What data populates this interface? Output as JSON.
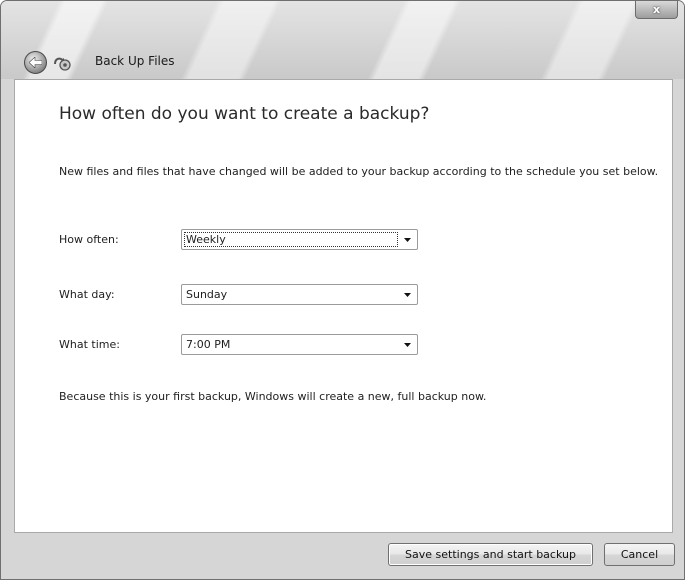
{
  "window": {
    "title": "Back Up Files",
    "close_glyph": "x",
    "icons": {
      "back": "back-arrow-icon",
      "app": "backup-app-icon",
      "close": "close-icon"
    }
  },
  "content": {
    "heading": "How often do you want to create a backup?",
    "description": "New files and files that have changed will be added to your backup according to the schedule you set below.",
    "fields": [
      {
        "label": "How often:",
        "value": "Weekly"
      },
      {
        "label": "What day:",
        "value": "Sunday"
      },
      {
        "label": "What time:",
        "value": "7:00 PM"
      }
    ],
    "note": "Because this is your first backup, Windows will create a new, full backup now."
  },
  "buttons": {
    "save": "Save settings and start backup",
    "cancel": "Cancel"
  }
}
